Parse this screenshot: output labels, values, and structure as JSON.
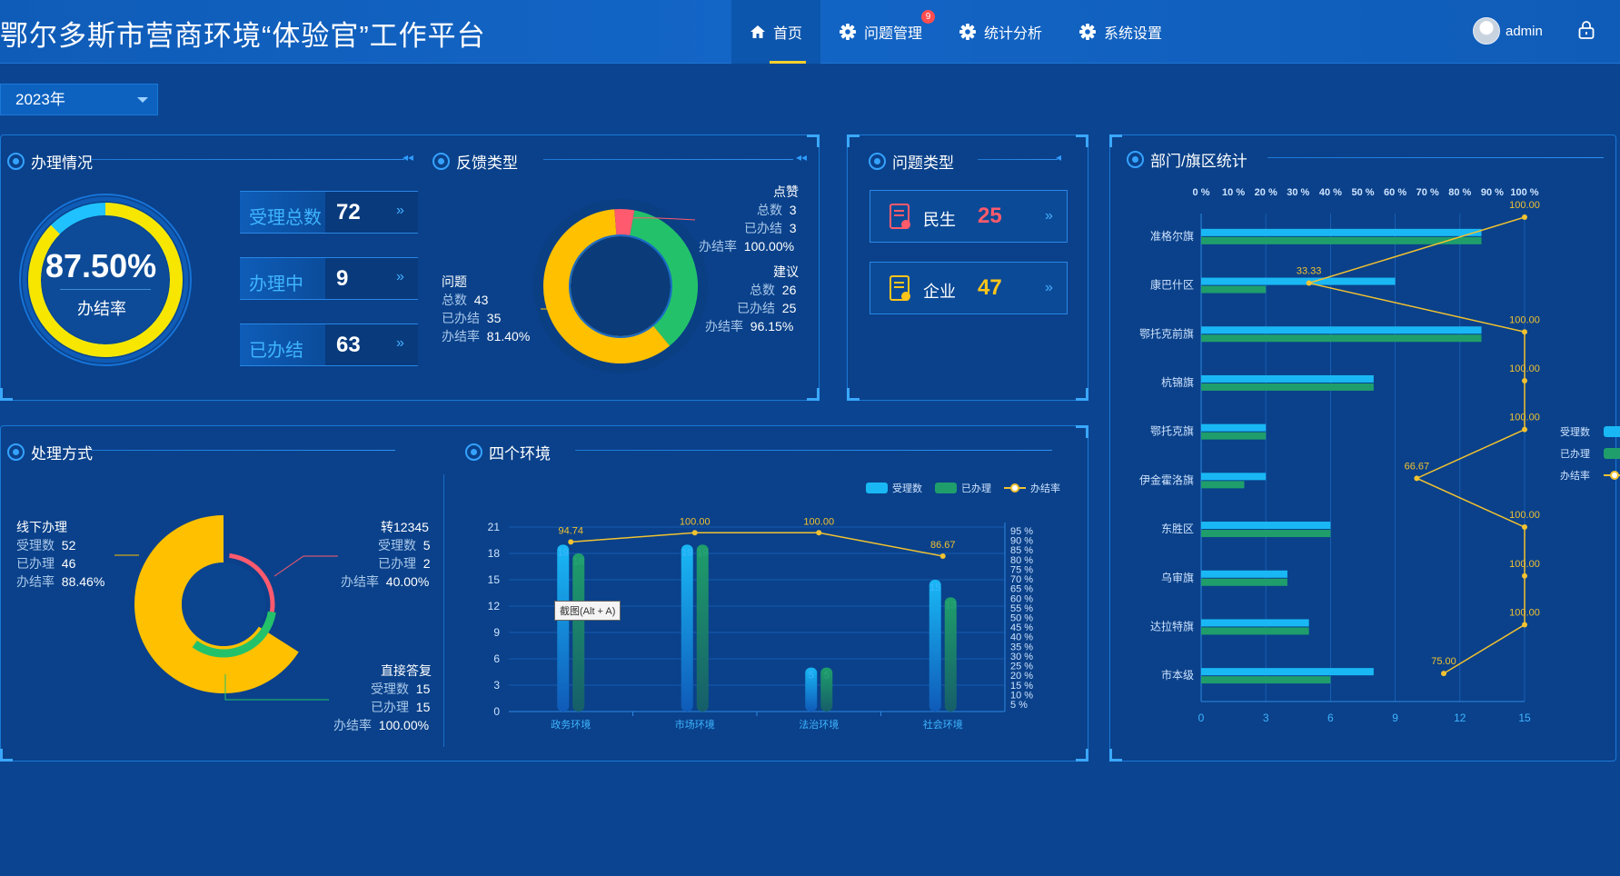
{
  "header": {
    "title": "鄂尔多斯市营商环境“体验官”工作平台",
    "nav": [
      {
        "label": "首页",
        "icon": "home-icon",
        "active": true
      },
      {
        "label": "问题管理",
        "icon": "gear-icon",
        "badge": "9"
      },
      {
        "label": "统计分析",
        "icon": "gear-icon"
      },
      {
        "label": "系统设置",
        "icon": "gear-icon"
      }
    ],
    "user": "admin"
  },
  "year_select": {
    "value": "2023年"
  },
  "handling": {
    "title": "办理情况",
    "gauge_value": "87.50%",
    "gauge_label": "办结率",
    "gauge_fraction": 0.875,
    "rows": [
      {
        "label": "受理总数",
        "value": "72"
      },
      {
        "label": "办理中",
        "value": "9"
      },
      {
        "label": "已办结",
        "value": "63"
      }
    ]
  },
  "feedback": {
    "title": "反馈类型",
    "problem": {
      "name": "问题",
      "total_label": "总数",
      "total": "43",
      "done_label": "已办结",
      "done": "35",
      "rate_label": "办结率",
      "rate": "81.40%"
    },
    "like": {
      "name": "点赞",
      "total_label": "总数",
      "total": "3",
      "done_label": "已办结",
      "done": "3",
      "rate_label": "办结率",
      "rate": "100.00%"
    },
    "suggest": {
      "name": "建议",
      "total_label": "总数",
      "total": "26",
      "done_label": "已办结",
      "done": "25",
      "rate_label": "办结率",
      "rate": "96.15%"
    }
  },
  "issue_type": {
    "title": "问题类型",
    "items": [
      {
        "label": "民生",
        "value": "25",
        "color": "#ff5b6b",
        "icon": "document-icon"
      },
      {
        "label": "企业",
        "value": "47",
        "color": "#ffc51a",
        "icon": "document-icon"
      }
    ]
  },
  "method": {
    "title": "处理方式",
    "offline": {
      "name": "线下办理",
      "l1": "受理数",
      "v1": "52",
      "l2": "已办理",
      "v2": "46",
      "l3": "办结率",
      "v3": "88.46%"
    },
    "hotline": {
      "name": "转12345",
      "l1": "受理数",
      "v1": "5",
      "l2": "已办理",
      "v2": "2",
      "l3": "办结率",
      "v3": "40.00%"
    },
    "direct": {
      "name": "直接答复",
      "l1": "受理数",
      "v1": "15",
      "l2": "已办理",
      "v2": "15",
      "l3": "办结率",
      "v3": "100.00%"
    }
  },
  "env": {
    "title": "四个环境",
    "tooltip": "截图(Alt + A)"
  },
  "dept": {
    "title": "部门/旗区统计"
  },
  "chart_data": [
    {
      "type": "pie",
      "title": "反馈类型",
      "categories": [
        "问题",
        "点赞",
        "建议"
      ],
      "values": [
        43,
        3,
        26
      ],
      "colors": [
        "#ffc000",
        "#ff5a6e",
        "#23c26a"
      ]
    },
    {
      "type": "pie",
      "title": "处理方式",
      "categories": [
        "线下办理",
        "转12345",
        "直接答复"
      ],
      "values": [
        52,
        5,
        15
      ],
      "colors": [
        "#ffc000",
        "#ff5a6e",
        "#23c26a"
      ]
    },
    {
      "type": "bar",
      "title": "四个环境",
      "categories": [
        "政务环境",
        "市场环境",
        "法治环境",
        "社会环境"
      ],
      "series": [
        {
          "name": "受理数",
          "values": [
            19,
            19,
            5,
            15
          ],
          "color": "#19b8f5"
        },
        {
          "name": "已办理",
          "values": [
            18,
            19,
            5,
            13
          ],
          "color": "#1f9e6b"
        },
        {
          "name": "办结率",
          "type": "line",
          "values": [
            94.74,
            100.0,
            100.0,
            86.67
          ],
          "labels": [
            "94.74",
            "100.00",
            "100.00",
            "86.67"
          ],
          "color": "#f2c230"
        }
      ],
      "ylim": [
        0,
        21
      ],
      "yticks": [
        0,
        3,
        6,
        9,
        12,
        15,
        18,
        21
      ],
      "y2ticks": [
        "5 %",
        "10 %",
        "15 %",
        "20 %",
        "25 %",
        "30 %",
        "35 %",
        "40 %",
        "45 %",
        "50 %",
        "55 %",
        "60 %",
        "65 %",
        "70 %",
        "75 %",
        "80 %",
        "85 %",
        "90 %",
        "95 %"
      ],
      "legend": "top-right"
    },
    {
      "type": "bar",
      "orientation": "horizontal",
      "title": "部门/旗区统计",
      "categories": [
        "准格尔旗",
        "康巴什区",
        "鄂托克前旗",
        "杭锦旗",
        "鄂托克旗",
        "伊金霍洛旗",
        "东胜区",
        "乌审旗",
        "达拉特旗",
        "市本级"
      ],
      "series": [
        {
          "name": "受理数",
          "values": [
            13,
            9,
            13,
            8,
            3,
            3,
            6,
            4,
            5,
            8
          ],
          "color": "#19b8f5"
        },
        {
          "name": "已办理",
          "values": [
            13,
            3,
            13,
            8,
            3,
            2,
            6,
            4,
            5,
            6
          ],
          "color": "#1f9e6b"
        },
        {
          "name": "办结率",
          "type": "line",
          "values": [
            100.0,
            33.33,
            100.0,
            100.0,
            100.0,
            66.67,
            100.0,
            100.0,
            100.0,
            75.0
          ],
          "labels": [
            "100.00",
            "33.33",
            "100.00",
            "100.00",
            "100.00",
            "66.67",
            "100.00",
            "100.00",
            "100.00",
            "75.00"
          ],
          "color": "#f2c230"
        }
      ],
      "xlim": [
        0,
        15
      ],
      "xticks": [
        0,
        3,
        6,
        9,
        12,
        15
      ],
      "x2ticks": [
        "0 %",
        "10 %",
        "20 %",
        "30 %",
        "40 %",
        "50 %",
        "60 %",
        "70 %",
        "80 %",
        "90 %",
        "100 %"
      ],
      "legend": "right"
    }
  ]
}
